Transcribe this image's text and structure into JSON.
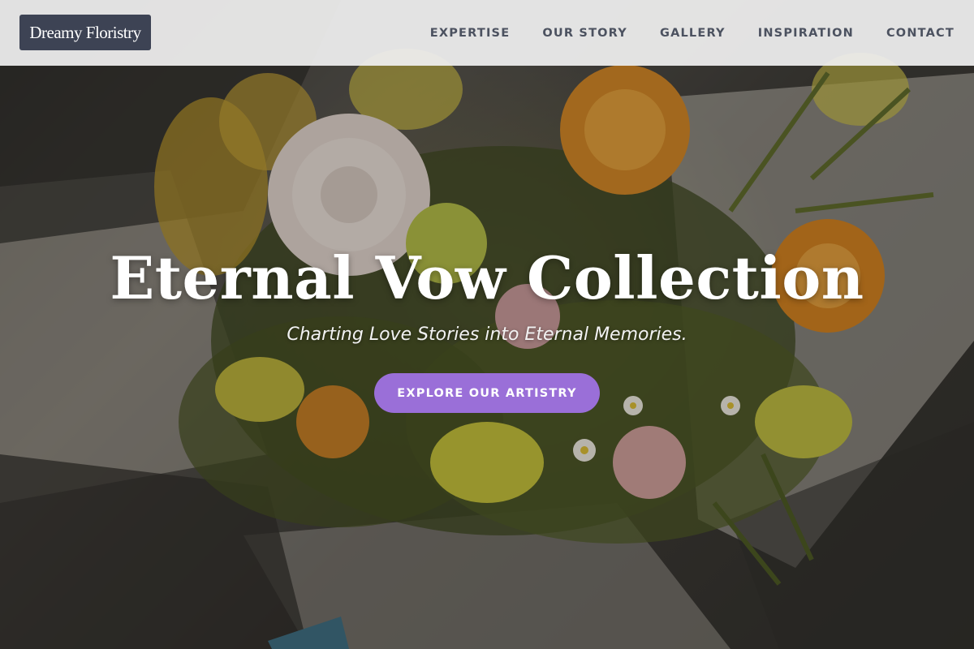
{
  "header": {
    "brand": "Dreamy Floristry",
    "nav": [
      "EXPERTISE",
      "OUR STORY",
      "GALLERY",
      "INSPIRATION",
      "CONTACT"
    ]
  },
  "hero": {
    "title": "Eternal Vow Collection",
    "tagline": "Charting Love Stories into Eternal Memories.",
    "cta_label": "EXPLORE OUR ARTISTRY",
    "background_image": "floral-bouquet-photo"
  },
  "colors": {
    "brand_bg": "#3d4354",
    "nav_text": "#4c5260",
    "cta_bg": "#9a6fd8",
    "topbar_bg": "#f0f0f0"
  }
}
